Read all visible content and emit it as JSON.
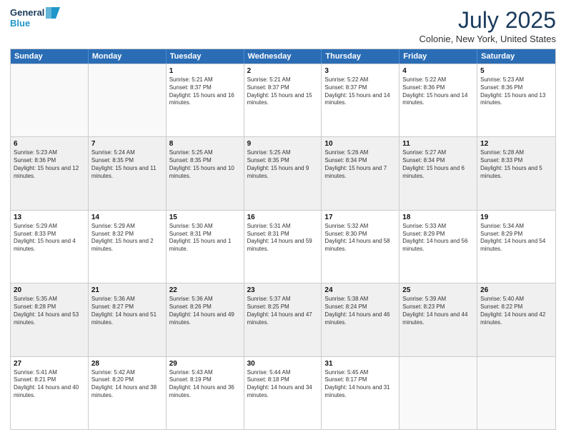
{
  "logo": {
    "line1": "General",
    "line2": "Blue"
  },
  "title": "July 2025",
  "subtitle": "Colonie, New York, United States",
  "days": [
    "Sunday",
    "Monday",
    "Tuesday",
    "Wednesday",
    "Thursday",
    "Friday",
    "Saturday"
  ],
  "weeks": [
    [
      {
        "day": "",
        "sunrise": "",
        "sunset": "",
        "daylight": "",
        "empty": true
      },
      {
        "day": "",
        "sunrise": "",
        "sunset": "",
        "daylight": "",
        "empty": true
      },
      {
        "day": "1",
        "sunrise": "Sunrise: 5:21 AM",
        "sunset": "Sunset: 8:37 PM",
        "daylight": "Daylight: 15 hours and 16 minutes."
      },
      {
        "day": "2",
        "sunrise": "Sunrise: 5:21 AM",
        "sunset": "Sunset: 8:37 PM",
        "daylight": "Daylight: 15 hours and 15 minutes."
      },
      {
        "day": "3",
        "sunrise": "Sunrise: 5:22 AM",
        "sunset": "Sunset: 8:37 PM",
        "daylight": "Daylight: 15 hours and 14 minutes."
      },
      {
        "day": "4",
        "sunrise": "Sunrise: 5:22 AM",
        "sunset": "Sunset: 8:36 PM",
        "daylight": "Daylight: 15 hours and 14 minutes."
      },
      {
        "day": "5",
        "sunrise": "Sunrise: 5:23 AM",
        "sunset": "Sunset: 8:36 PM",
        "daylight": "Daylight: 15 hours and 13 minutes."
      }
    ],
    [
      {
        "day": "6",
        "sunrise": "Sunrise: 5:23 AM",
        "sunset": "Sunset: 8:36 PM",
        "daylight": "Daylight: 15 hours and 12 minutes."
      },
      {
        "day": "7",
        "sunrise": "Sunrise: 5:24 AM",
        "sunset": "Sunset: 8:35 PM",
        "daylight": "Daylight: 15 hours and 11 minutes."
      },
      {
        "day": "8",
        "sunrise": "Sunrise: 5:25 AM",
        "sunset": "Sunset: 8:35 PM",
        "daylight": "Daylight: 15 hours and 10 minutes."
      },
      {
        "day": "9",
        "sunrise": "Sunrise: 5:25 AM",
        "sunset": "Sunset: 8:35 PM",
        "daylight": "Daylight: 15 hours and 9 minutes."
      },
      {
        "day": "10",
        "sunrise": "Sunrise: 5:26 AM",
        "sunset": "Sunset: 8:34 PM",
        "daylight": "Daylight: 15 hours and 7 minutes."
      },
      {
        "day": "11",
        "sunrise": "Sunrise: 5:27 AM",
        "sunset": "Sunset: 8:34 PM",
        "daylight": "Daylight: 15 hours and 6 minutes."
      },
      {
        "day": "12",
        "sunrise": "Sunrise: 5:28 AM",
        "sunset": "Sunset: 8:33 PM",
        "daylight": "Daylight: 15 hours and 5 minutes."
      }
    ],
    [
      {
        "day": "13",
        "sunrise": "Sunrise: 5:29 AM",
        "sunset": "Sunset: 8:33 PM",
        "daylight": "Daylight: 15 hours and 4 minutes."
      },
      {
        "day": "14",
        "sunrise": "Sunrise: 5:29 AM",
        "sunset": "Sunset: 8:32 PM",
        "daylight": "Daylight: 15 hours and 2 minutes."
      },
      {
        "day": "15",
        "sunrise": "Sunrise: 5:30 AM",
        "sunset": "Sunset: 8:31 PM",
        "daylight": "Daylight: 15 hours and 1 minute."
      },
      {
        "day": "16",
        "sunrise": "Sunrise: 5:31 AM",
        "sunset": "Sunset: 8:31 PM",
        "daylight": "Daylight: 14 hours and 59 minutes."
      },
      {
        "day": "17",
        "sunrise": "Sunrise: 5:32 AM",
        "sunset": "Sunset: 8:30 PM",
        "daylight": "Daylight: 14 hours and 58 minutes."
      },
      {
        "day": "18",
        "sunrise": "Sunrise: 5:33 AM",
        "sunset": "Sunset: 8:29 PM",
        "daylight": "Daylight: 14 hours and 56 minutes."
      },
      {
        "day": "19",
        "sunrise": "Sunrise: 5:34 AM",
        "sunset": "Sunset: 8:29 PM",
        "daylight": "Daylight: 14 hours and 54 minutes."
      }
    ],
    [
      {
        "day": "20",
        "sunrise": "Sunrise: 5:35 AM",
        "sunset": "Sunset: 8:28 PM",
        "daylight": "Daylight: 14 hours and 53 minutes."
      },
      {
        "day": "21",
        "sunrise": "Sunrise: 5:36 AM",
        "sunset": "Sunset: 8:27 PM",
        "daylight": "Daylight: 14 hours and 51 minutes."
      },
      {
        "day": "22",
        "sunrise": "Sunrise: 5:36 AM",
        "sunset": "Sunset: 8:26 PM",
        "daylight": "Daylight: 14 hours and 49 minutes."
      },
      {
        "day": "23",
        "sunrise": "Sunrise: 5:37 AM",
        "sunset": "Sunset: 8:25 PM",
        "daylight": "Daylight: 14 hours and 47 minutes."
      },
      {
        "day": "24",
        "sunrise": "Sunrise: 5:38 AM",
        "sunset": "Sunset: 8:24 PM",
        "daylight": "Daylight: 14 hours and 46 minutes."
      },
      {
        "day": "25",
        "sunrise": "Sunrise: 5:39 AM",
        "sunset": "Sunset: 8:23 PM",
        "daylight": "Daylight: 14 hours and 44 minutes."
      },
      {
        "day": "26",
        "sunrise": "Sunrise: 5:40 AM",
        "sunset": "Sunset: 8:22 PM",
        "daylight": "Daylight: 14 hours and 42 minutes."
      }
    ],
    [
      {
        "day": "27",
        "sunrise": "Sunrise: 5:41 AM",
        "sunset": "Sunset: 8:21 PM",
        "daylight": "Daylight: 14 hours and 40 minutes."
      },
      {
        "day": "28",
        "sunrise": "Sunrise: 5:42 AM",
        "sunset": "Sunset: 8:20 PM",
        "daylight": "Daylight: 14 hours and 38 minutes."
      },
      {
        "day": "29",
        "sunrise": "Sunrise: 5:43 AM",
        "sunset": "Sunset: 8:19 PM",
        "daylight": "Daylight: 14 hours and 36 minutes."
      },
      {
        "day": "30",
        "sunrise": "Sunrise: 5:44 AM",
        "sunset": "Sunset: 8:18 PM",
        "daylight": "Daylight: 14 hours and 34 minutes."
      },
      {
        "day": "31",
        "sunrise": "Sunrise: 5:45 AM",
        "sunset": "Sunset: 8:17 PM",
        "daylight": "Daylight: 14 hours and 31 minutes."
      },
      {
        "day": "",
        "sunrise": "",
        "sunset": "",
        "daylight": "",
        "empty": true
      },
      {
        "day": "",
        "sunrise": "",
        "sunset": "",
        "daylight": "",
        "empty": true
      }
    ]
  ]
}
